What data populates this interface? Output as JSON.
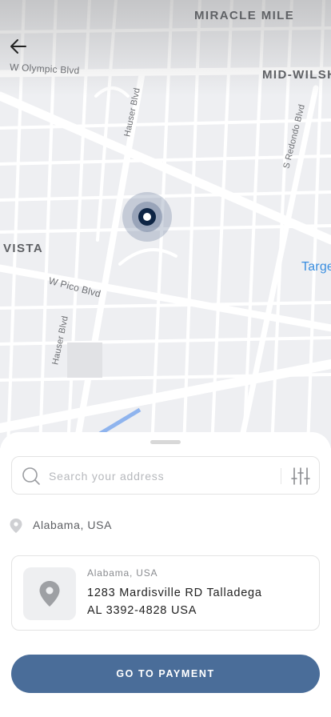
{
  "map": {
    "labels": {
      "miracle_mile": "MIRACLE MILE",
      "mid_wilshire": "MID-WILSH",
      "w_olympic": "W Olympic Blvd",
      "hauser_top": "Hauser Blvd",
      "s_redondo": "S Redondo Blvd",
      "vista": "VISTA",
      "target": "Targe",
      "w_pico": "W Pico Blvd",
      "hauser_bottom": "Hauser Blvd"
    },
    "colors": {
      "marker": "#0e2545",
      "poi": "#3a8ee0",
      "water": "#8fb4ee"
    }
  },
  "header": {
    "back_icon": "arrow-left-icon"
  },
  "search": {
    "placeholder": "Search your address",
    "value": "",
    "icon": "search-icon",
    "filter_icon": "sliders-icon"
  },
  "current_location": {
    "icon": "map-pin-icon",
    "label": "Alabama, USA"
  },
  "address_card": {
    "icon": "map-pin-icon",
    "region": "Alabama, USA",
    "line1": "1283 Mardisville RD Talladega",
    "line2": "AL 3392-4828 USA"
  },
  "cta": {
    "label": "GO TO PAYMENT",
    "color": "#4a6d99"
  }
}
